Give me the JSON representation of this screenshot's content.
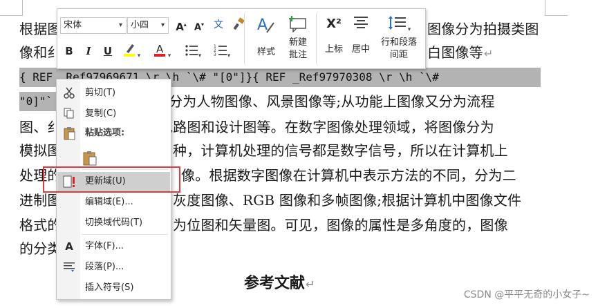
{
  "document": {
    "lines": [
      "根据图",
      "像和纟",
      "图、纟",
      "模拟图",
      "处理的",
      "进制图",
      "格式的",
      "的分类"
    ],
    "right_fragments": [
      "图像分为拍摄类图",
      "白图像等",
      "分为人物图像、风景图像等;从功能上图像又分为流程",
      "电路图和设计图等。在数字图像处理领域，将图像分为",
      "种，计算机处理的信号都是数字信号，所以在计算机上",
      "像。根据数字图像在计算机中表示方法的不同，分为二",
      "灰度图像、RGB 图像和多帧图像;根据计算机中图像文件",
      "为位图和矢量图。可见，图像的属性是多角度的，图像"
    ],
    "field_line_1": "{ REF _Ref97969671 \\r \\h `\\# \"[0\"]}{ REF _Ref97970308 \\r \\h `\\#",
    "field_line_2": "\"0]\"`",
    "paragraph_mark": "↵",
    "heading": "参考文献"
  },
  "watermark": "CSDN @平平无奇的小女子~",
  "toolbar": {
    "font_name": "宋体",
    "font_size": "小四",
    "labels": {
      "styles": "样式",
      "new_comment": "新建\n批注",
      "superscript": "上标",
      "center": "居中",
      "line_spacing": "行和段落\n间距"
    },
    "buttons": {
      "bold": "B",
      "italic": "I",
      "underline": "U",
      "grow_font": "A",
      "shrink_font": "A",
      "phonetic": "文",
      "superscript_glyph": "X²"
    },
    "colors": {
      "highlight": "#ffff00",
      "font_color": "#e02020"
    }
  },
  "context_menu": {
    "items": [
      {
        "label": "剪切(T)",
        "icon": "scissors-icon"
      },
      {
        "label": "复制(C)",
        "icon": "copy-icon"
      },
      {
        "label": "粘贴选项:",
        "icon": "paste-icon"
      },
      {
        "label": "更新域(U)",
        "icon": "update-field-icon"
      },
      {
        "label": "编辑域(E)...",
        "icon": ""
      },
      {
        "label": "切换域代码(T)",
        "icon": ""
      },
      {
        "label": "字体(F)...",
        "icon": "font-icon"
      },
      {
        "label": "段落(P)...",
        "icon": "paragraph-icon"
      },
      {
        "label": "插入符号(S)",
        "icon": ""
      }
    ]
  },
  "highlight_color": "#e0393e"
}
